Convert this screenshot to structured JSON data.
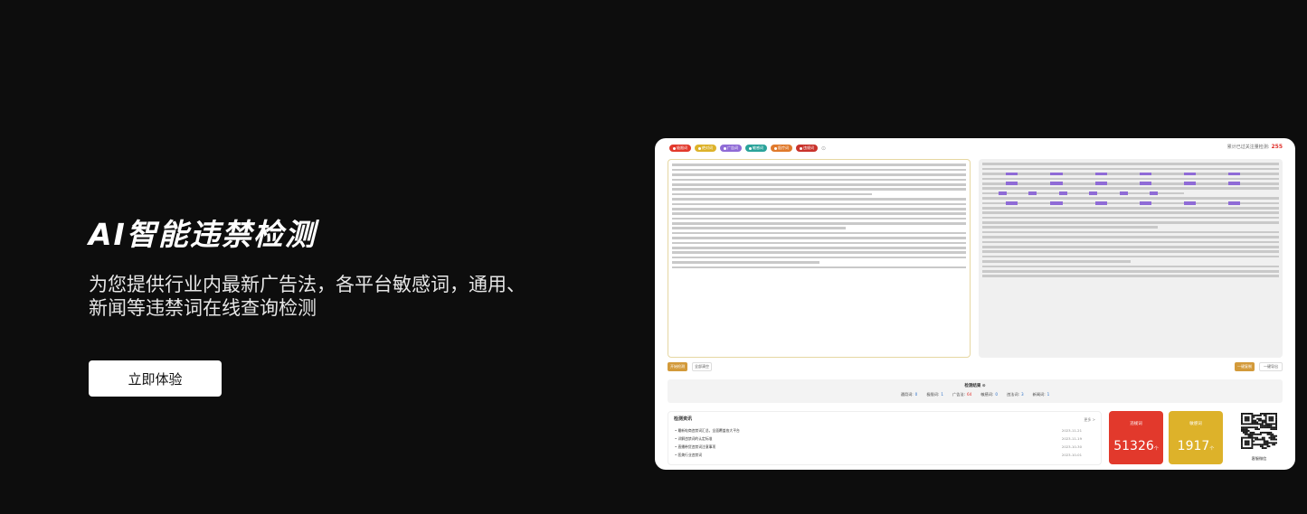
{
  "hero": {
    "title": "AI智能违禁检测",
    "subtitle": "为您提供行业内最新广告法，各平台敏感词，通用、新闻等违禁词在线查询检测",
    "cta_label": "立即体验"
  },
  "chips": [
    {
      "label": "极限词",
      "color": "#e2392c"
    },
    {
      "label": "绝对词",
      "color": "#ddb22a"
    },
    {
      "label": "广告词",
      "color": "#8f6bd6"
    },
    {
      "label": "敏感词",
      "color": "#2aa39a"
    },
    {
      "label": "医疗词",
      "color": "#e07a2c"
    },
    {
      "label": "违规词",
      "color": "#c9332c"
    }
  ],
  "chip_more": "⊙",
  "counter": {
    "label": "累计已过关注量检测:",
    "value": "255"
  },
  "buttons": {
    "detect": "开始检测",
    "clear": "全部清空",
    "copy": "一键复制",
    "export": "一键导出"
  },
  "result": {
    "title": "检测结果 ⊙",
    "stats": [
      {
        "label": "通用词:",
        "value": "0"
      },
      {
        "label": "极限词:",
        "value": "1"
      },
      {
        "label": "广告法:",
        "value": "64",
        "red": true
      },
      {
        "label": "敏感词:",
        "value": "0"
      },
      {
        "label": "违法词:",
        "value": "3"
      },
      {
        "label": "新闻词:",
        "value": "1"
      }
    ]
  },
  "news": {
    "title": "检测资讯",
    "more": "更多 >",
    "items": [
      {
        "title": "• 最新电商违禁词汇总，全面覆盖各大平台",
        "date": "2023-11-21"
      },
      {
        "title": "• 详解违禁词的认定标准",
        "date": "2023-11-19"
      },
      {
        "title": "• 直播带货违禁词注意事项",
        "date": "2023-10-30"
      },
      {
        "title": "• 医美行业违禁词",
        "date": "2023-10-01"
      }
    ]
  },
  "stat_red": {
    "label": "违规词",
    "value": "51326",
    "unit": "个"
  },
  "stat_yellow": {
    "label": "敏感词",
    "value": "1917",
    "unit": "个"
  },
  "qr_label": "客服微信"
}
